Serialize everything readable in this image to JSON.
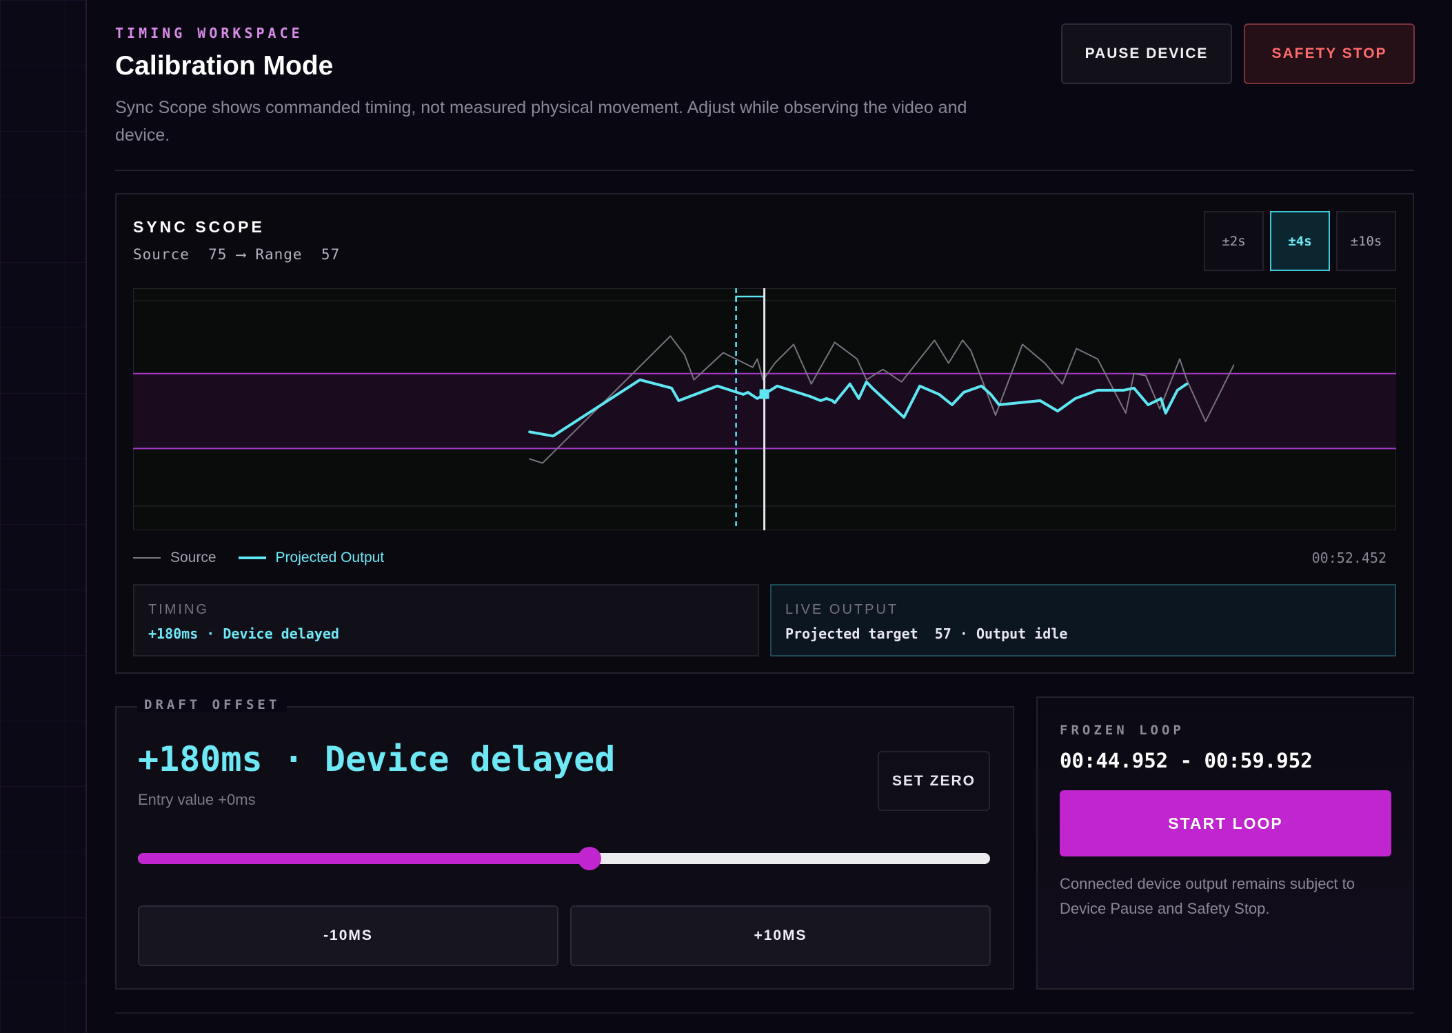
{
  "header": {
    "eyebrow": "TIMING WORKSPACE",
    "title": "Calibration Mode",
    "subtitle": "Sync Scope shows commanded timing, not measured physical movement. Adjust while observing the video and device.",
    "pause_label": "PAUSE DEVICE",
    "safety_label": "SAFETY STOP"
  },
  "scope": {
    "title": "SYNC SCOPE",
    "subtitle": "Source  75 ⟶ Range  57",
    "ranges": [
      {
        "label": "±2s",
        "active": false
      },
      {
        "label": "±4s",
        "active": true
      },
      {
        "label": "±10s",
        "active": false
      }
    ],
    "legend_source": "Source",
    "legend_projected": "Projected Output",
    "timestamp": "00:52.452",
    "timing_label": "TIMING",
    "timing_value": "+180ms · Device delayed",
    "live_label": "LIVE OUTPUT",
    "live_value": "Projected target  57 · Output idle"
  },
  "colors": {
    "accent_cyan": "#5ee6f2",
    "accent_magenta": "#c125cf",
    "danger": "#ff6b6b",
    "range_band": "#a638c8"
  },
  "draft": {
    "legend": "DRAFT OFFSET",
    "value": "+180ms · Device delayed",
    "entry": "Entry value +0ms",
    "set_zero_label": "SET ZERO",
    "slider_fraction": 0.53,
    "minus_label": "-10MS",
    "plus_label": "+10MS"
  },
  "loop": {
    "label": "FROZEN LOOP",
    "range": "00:44.952 - 00:59.952",
    "start_label": "START LOOP",
    "note": "Connected device output remains subject to Device Pause and Safety Stop."
  },
  "chart_data": {
    "type": "line",
    "x_unit": "s",
    "xlim": [
      -4,
      4
    ],
    "ylim": [
      0,
      100
    ],
    "range_band": [
      29,
      65
    ],
    "cursor_x": 0,
    "delay_offset": -0.18,
    "series": [
      {
        "name": "Source",
        "x": [
          -4,
          -3.78,
          -1.6,
          -1.36,
          -1.2,
          -0.7,
          -0.2,
          -0.12,
          -0.02,
          0.18,
          0.5,
          0.8,
          1.2,
          1.58,
          1.74,
          2.02,
          2.34,
          2.9,
          3.14,
          3.38,
          3.52,
          3.94,
          4.4,
          4.78,
          5.08,
          5.32,
          5.68,
          6.16,
          6.3,
          6.5,
          6.74,
          7.08,
          7.2,
          7.52,
          8
        ],
        "y": [
          24,
          22,
          83,
          74,
          62,
          75,
          68,
          72,
          62,
          70,
          79,
          60,
          80,
          72,
          62,
          67,
          61,
          81,
          70,
          81,
          76,
          45,
          79,
          70,
          60,
          77,
          72,
          46,
          65,
          64,
          48,
          72,
          62,
          42,
          69
        ]
      },
      {
        "name": "Projected Output",
        "x": [
          -4,
          -3.6,
          -2.12,
          -1.58,
          -1.46,
          -0.8,
          -0.36,
          -0.28,
          -0.12,
          0.22,
          0.78,
          0.96,
          1.06,
          1.16,
          1.2,
          1.46,
          1.61,
          1.74,
          1.84,
          2.38,
          2.65,
          2.98,
          3.2,
          3.4,
          3.7,
          3.86,
          4.0,
          4.7,
          5.0,
          5.3,
          5.68,
          6.12,
          6.3,
          6.54,
          6.76,
          6.84,
          7.04,
          7.2
        ],
        "y": [
          37,
          35,
          62,
          58,
          52,
          59,
          55,
          56,
          53,
          59,
          54,
          52,
          53,
          52,
          51,
          60,
          53,
          61,
          58,
          44,
          59,
          55,
          50,
          56,
          59,
          55,
          50,
          52,
          47,
          53,
          57,
          57,
          58,
          50,
          53,
          46,
          57,
          60
        ]
      }
    ]
  }
}
